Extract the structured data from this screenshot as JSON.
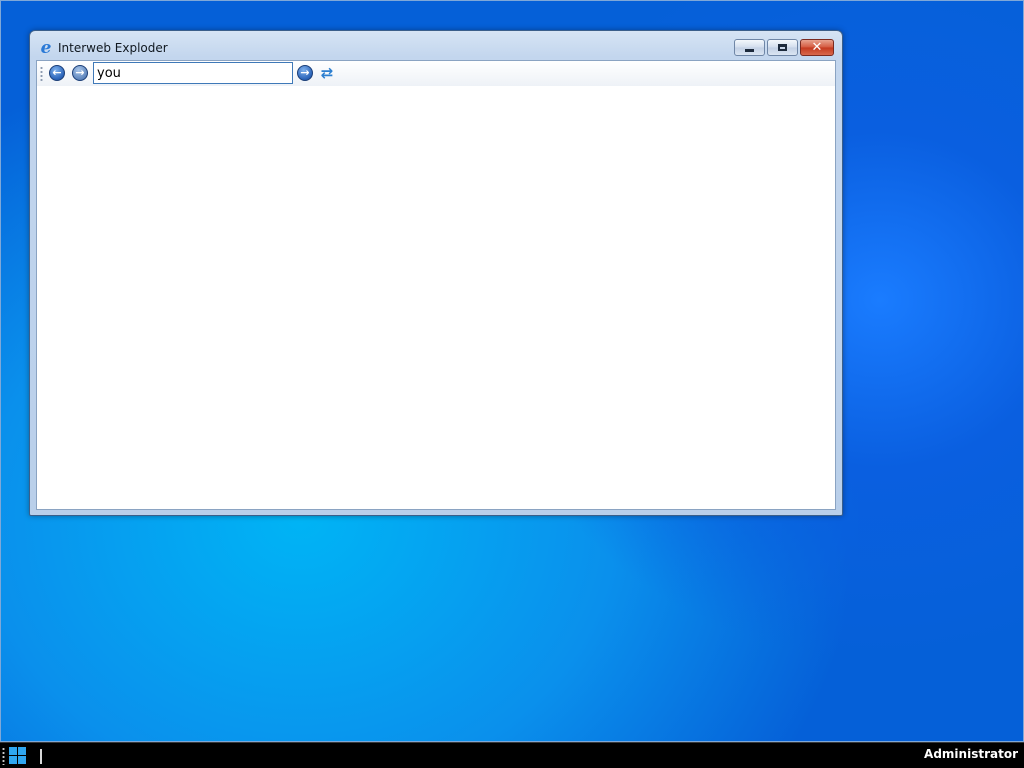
{
  "window": {
    "title": "Interweb Exploder",
    "app_icon": "e"
  },
  "toolbar": {
    "back_icon": "arrow-left-icon",
    "forward_icon": "arrow-right-icon",
    "url_value": "you",
    "go_icon": "go-arrow-icon",
    "refresh_icon": "refresh-icon"
  },
  "taskbar": {
    "user_label": "Administrator"
  },
  "colors": {
    "desktop_blue": "#0b4fcf",
    "start_tile": "#2fa6f0",
    "close_red": "#c4391f"
  }
}
